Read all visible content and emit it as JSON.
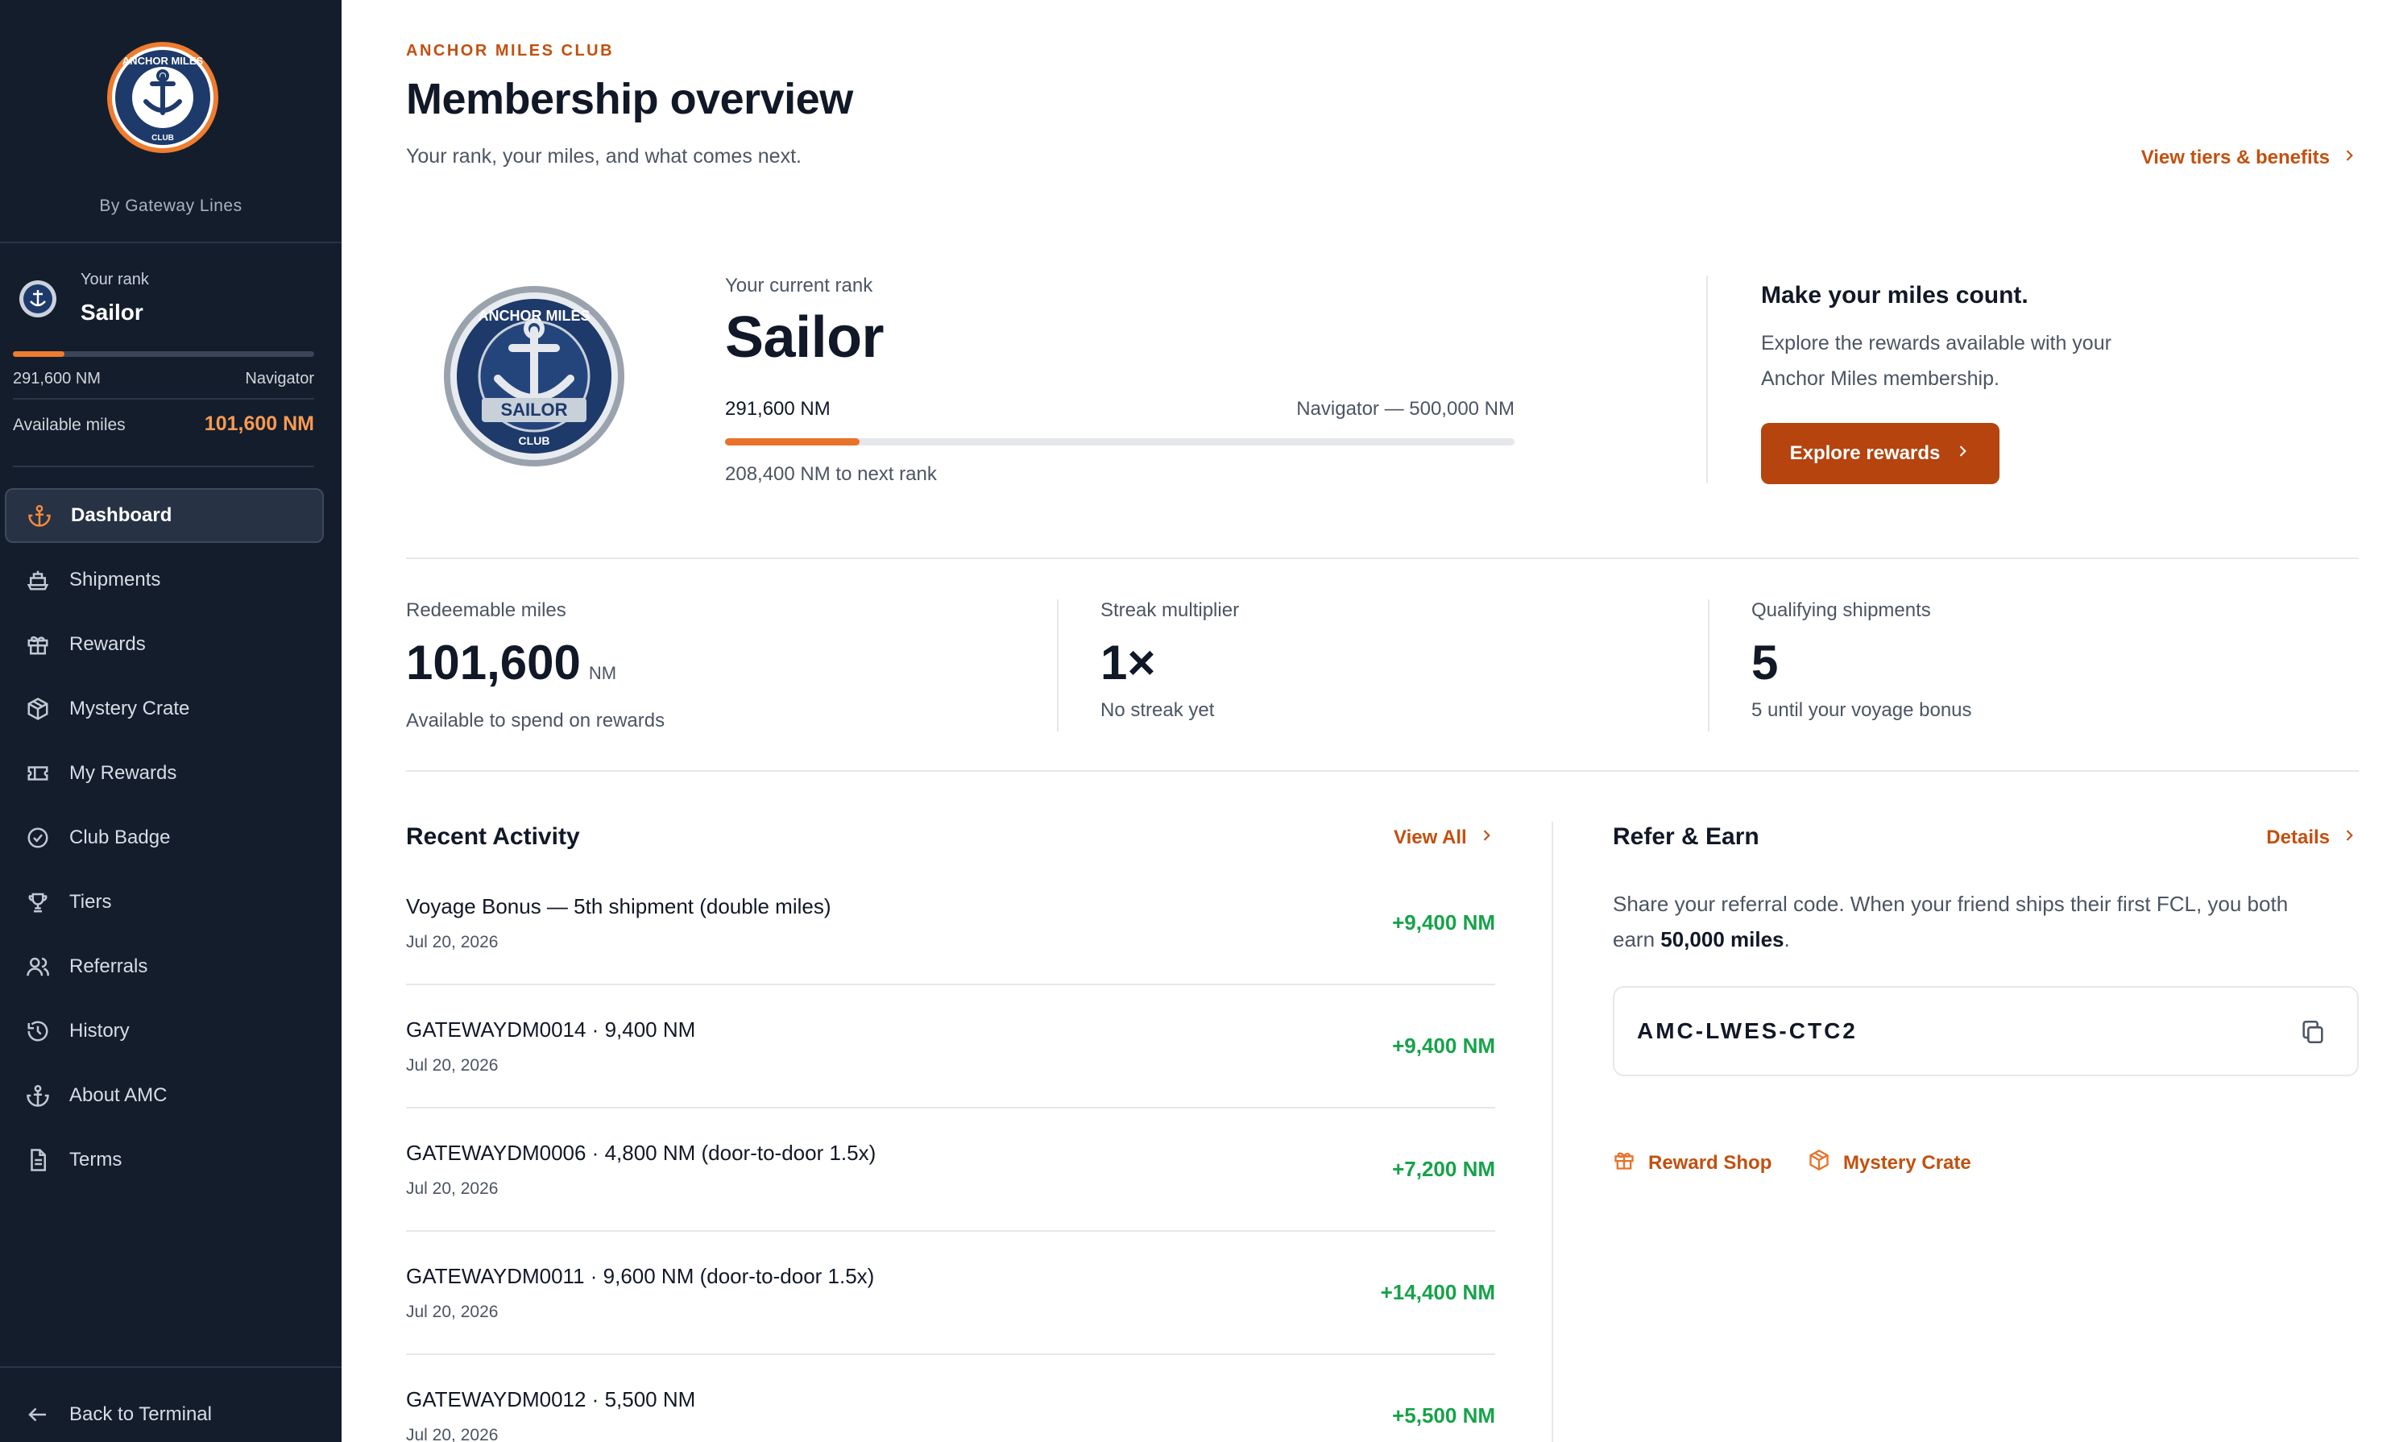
{
  "sidebar": {
    "brand_byline": "By Gateway Lines",
    "rank_label": "Your rank",
    "rank_name": "Sailor",
    "progress": 0.17,
    "current_nm": "291,600 NM",
    "next_rank": "Navigator",
    "available_label": "Available miles",
    "available_value": "101,600 NM",
    "nav": [
      {
        "label": "Dashboard",
        "icon": "anchor-icon",
        "active": true
      },
      {
        "label": "Shipments",
        "icon": "ship-icon"
      },
      {
        "label": "Rewards",
        "icon": "gift-icon"
      },
      {
        "label": "Mystery Crate",
        "icon": "box-icon"
      },
      {
        "label": "My Rewards",
        "icon": "ticket-icon"
      },
      {
        "label": "Club Badge",
        "icon": "check-circle-icon"
      },
      {
        "label": "Tiers",
        "icon": "trophy-icon"
      },
      {
        "label": "Referrals",
        "icon": "users-icon"
      },
      {
        "label": "History",
        "icon": "history-icon"
      },
      {
        "label": "About AMC",
        "icon": "anchor-icon"
      },
      {
        "label": "Terms",
        "icon": "document-icon"
      }
    ],
    "back_label": "Back to Terminal"
  },
  "header": {
    "eyebrow": "ANCHOR MILES CLUB",
    "title": "Membership overview",
    "subtitle": "Your rank, your miles, and what comes next.",
    "tiers_link": "View tiers & benefits"
  },
  "hero": {
    "rank_label": "Your current rank",
    "rank_name": "Sailor",
    "current_nm": "291,600 NM",
    "next_label": "Navigator — 500,000 NM",
    "progress": 0.17,
    "remaining": "208,400 NM to next rank",
    "promo_title": "Make your miles count.",
    "promo_text": "Explore the rewards available with your Anchor Miles membership.",
    "promo_button": "Explore rewards"
  },
  "stats": [
    {
      "label": "Redeemable miles",
      "value": "101,600",
      "unit": "NM",
      "note": "Available to spend on rewards"
    },
    {
      "label": "Streak multiplier",
      "value": "1×",
      "unit": "",
      "note": "No streak yet"
    },
    {
      "label": "Qualifying shipments",
      "value": "5",
      "unit": "",
      "note": "5 until your voyage bonus"
    }
  ],
  "activity": {
    "title": "Recent Activity",
    "view_all": "View All",
    "items": [
      {
        "title": "Voyage Bonus — 5th shipment (double miles)",
        "date": "Jul 20, 2026",
        "amount": "+9,400 NM"
      },
      {
        "title": "GATEWAYDM0014 · 9,400 NM",
        "date": "Jul 20, 2026",
        "amount": "+9,400 NM"
      },
      {
        "title": "GATEWAYDM0006 · 4,800 NM (door-to-door 1.5x)",
        "date": "Jul 20, 2026",
        "amount": "+7,200 NM"
      },
      {
        "title": "GATEWAYDM0011 · 9,600 NM (door-to-door 1.5x)",
        "date": "Jul 20, 2026",
        "amount": "+14,400 NM"
      },
      {
        "title": "GATEWAYDM0012 · 5,500 NM",
        "date": "Jul 20, 2026",
        "amount": "+5,500 NM"
      }
    ]
  },
  "refer": {
    "title": "Refer & Earn",
    "details": "Details",
    "text_before": "Share your referral code. When your friend ships their first FCL, you both earn ",
    "text_bold": "50,000 miles",
    "text_after": ".",
    "code": "AMC-LWES-CTC2",
    "links": [
      {
        "label": "Reward Shop",
        "icon": "gift-icon"
      },
      {
        "label": "Mystery Crate",
        "icon": "box-icon"
      }
    ]
  },
  "colors": {
    "sidebar_bg": "#141d2b",
    "accent": "#c2500f",
    "button": "#b5440f",
    "progress": "#e8722a",
    "positive": "#16a34a"
  }
}
